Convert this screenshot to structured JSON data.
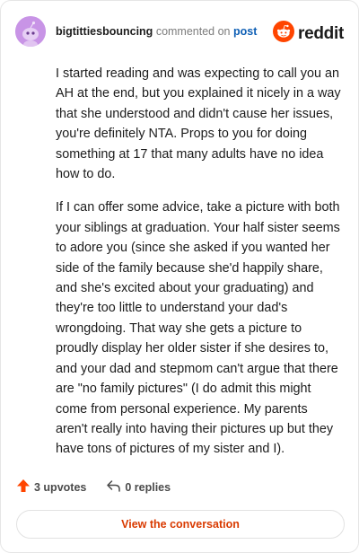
{
  "header": {
    "username": "bigtittiesbouncing",
    "action_text": "commented on",
    "post_link": "post",
    "brand": "reddit"
  },
  "comment": {
    "paragraphs": [
      "I started reading and was expecting to call you an AH at the end, but you explained it nicely in a way that she understood and didn't cause her issues, you're definitely NTA. Props to you for doing something at 17 that many adults have no idea how to do.",
      "If I can offer some advice, take a picture with both your siblings at graduation. Your half sister seems to adore you (since she asked if you wanted her side of the family because she'd happily share, and she's excited about your graduating) and they're too little to understand your dad's wrongdoing. That way she gets a picture to proudly display her older sister if she desires to, and your dad and stepmom can't argue that there are \"no family pictures\" (I do admit this might come from personal experience. My parents aren't really into having their pictures up but they have tons of pictures of my sister and I)."
    ]
  },
  "actions": {
    "upvotes": "3 upvotes",
    "replies": "0 replies"
  },
  "view_button": "View the conversation",
  "colors": {
    "accent": "#d93a00",
    "upvote": "#ff4500",
    "link": "#0e5fb5",
    "avatar_bg": "#c894e6",
    "brand_orange": "#ff4500"
  },
  "icons": {
    "avatar": "snoo-avatar-icon",
    "brand": "reddit-logo-icon",
    "upvote": "upvote-arrow-icon",
    "reply": "reply-arrow-icon"
  }
}
